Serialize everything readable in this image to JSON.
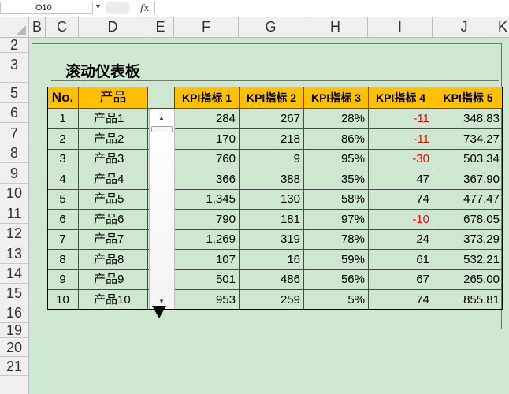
{
  "formula_bar": {
    "name_box": "O10",
    "fx_label": "fx",
    "formula": ""
  },
  "columns": [
    "B",
    "C",
    "D",
    "E",
    "F",
    "G",
    "H",
    "I",
    "J",
    "K"
  ],
  "rows": [
    "2",
    "3",
    "5",
    "6",
    "7",
    "8",
    "9",
    "10",
    "11",
    "12",
    "13",
    "14",
    "15",
    "16",
    "19",
    "20",
    "21"
  ],
  "dashboard": {
    "title": "滚动仪表板",
    "headers": {
      "no": "No.",
      "product": "产品",
      "kpi1": "KPI指标 1",
      "kpi2": "KPI指标 2",
      "kpi3": "KPI指标 3",
      "kpi4": "KPI指标 4",
      "kpi5": "KPI指标 5"
    },
    "rows": [
      {
        "no": "1",
        "product": "产品1",
        "kpi1": "284",
        "kpi2": "267",
        "kpi3": "28%",
        "kpi4": "-11",
        "kpi5": "348.83"
      },
      {
        "no": "2",
        "product": "产品2",
        "kpi1": "170",
        "kpi2": "218",
        "kpi3": "86%",
        "kpi4": "-11",
        "kpi5": "734.27"
      },
      {
        "no": "3",
        "product": "产品3",
        "kpi1": "760",
        "kpi2": "9",
        "kpi3": "95%",
        "kpi4": "-30",
        "kpi5": "503.34"
      },
      {
        "no": "4",
        "product": "产品4",
        "kpi1": "366",
        "kpi2": "388",
        "kpi3": "35%",
        "kpi4": "47",
        "kpi5": "367.90"
      },
      {
        "no": "5",
        "product": "产品5",
        "kpi1": "1,345",
        "kpi2": "130",
        "kpi3": "58%",
        "kpi4": "74",
        "kpi5": "477.47"
      },
      {
        "no": "6",
        "product": "产品6",
        "kpi1": "790",
        "kpi2": "181",
        "kpi3": "97%",
        "kpi4": "-10",
        "kpi5": "678.05"
      },
      {
        "no": "7",
        "product": "产品7",
        "kpi1": "1,269",
        "kpi2": "319",
        "kpi3": "78%",
        "kpi4": "24",
        "kpi5": "373.29"
      },
      {
        "no": "8",
        "product": "产品8",
        "kpi1": "107",
        "kpi2": "16",
        "kpi3": "59%",
        "kpi4": "61",
        "kpi5": "532.21"
      },
      {
        "no": "9",
        "product": "产品9",
        "kpi1": "501",
        "kpi2": "486",
        "kpi3": "56%",
        "kpi4": "67",
        "kpi5": "265.00"
      },
      {
        "no": "10",
        "product": "产品10",
        "kpi1": "953",
        "kpi2": "259",
        "kpi3": "5%",
        "kpi4": "74",
        "kpi5": "855.81"
      }
    ]
  },
  "colors": {
    "header_fill": "#ffc000",
    "negative": "#ff0000",
    "sheet_bg": "#cfe6d0"
  },
  "icons": {
    "scroll_up": "chevron-up-icon",
    "scroll_down": "chevron-down-icon",
    "dropdown": "triangle-down-icon"
  }
}
